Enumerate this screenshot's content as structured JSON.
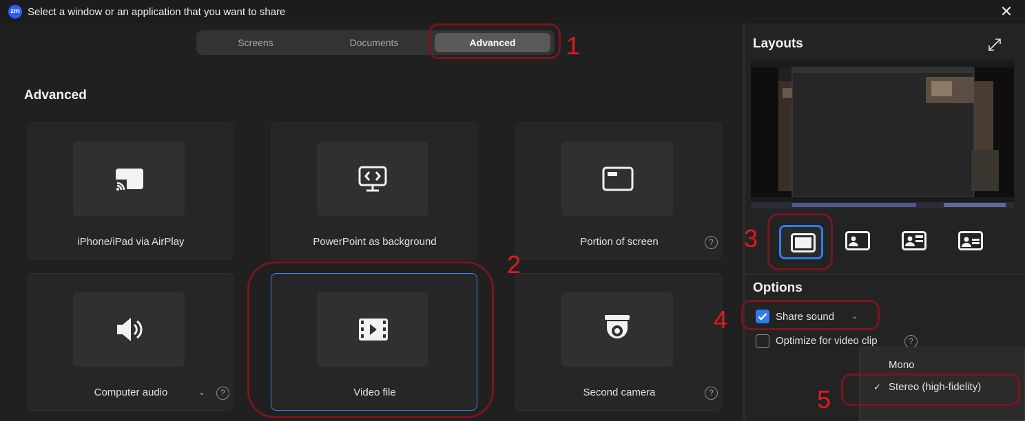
{
  "titlebar": {
    "logo": "zm",
    "title": "Select a window or an application that you want to share",
    "close": "✕"
  },
  "tabs": [
    {
      "label": "Screens",
      "selected": false
    },
    {
      "label": "Documents",
      "selected": false
    },
    {
      "label": "Advanced",
      "selected": true
    }
  ],
  "section_title": "Advanced",
  "cards": [
    {
      "label": "iPhone/iPad via AirPlay",
      "icon": "airplay-icon"
    },
    {
      "label": "PowerPoint as background",
      "icon": "powerpoint-slide-icon"
    },
    {
      "label": "Portion of screen",
      "icon": "portion-screen-icon",
      "help": "?"
    },
    {
      "label": "Computer audio",
      "icon": "speaker-icon",
      "help": "?",
      "chevron": "⌄"
    },
    {
      "label": "Video file",
      "icon": "video-file-icon",
      "selected": true
    },
    {
      "label": "Second camera",
      "icon": "camera-icon",
      "help": "?"
    }
  ],
  "right": {
    "layouts_title": "Layouts",
    "options_title": "Options",
    "layout_buttons": [
      "layout-screen-only-icon",
      "layout-person-left-icon",
      "layout-person-center-icon",
      "layout-person-right-icon"
    ],
    "share_sound": {
      "label": "Share sound",
      "checked": true,
      "chevron": "⌄"
    },
    "optimize": {
      "label": "Optimize for video clip",
      "checked": false,
      "help": "?"
    },
    "dropdown": [
      {
        "label": "Mono",
        "checked": false,
        "check": ""
      },
      {
        "label": "Stereo (high-fidelity)",
        "checked": true,
        "check": "✓"
      }
    ]
  },
  "annotations": [
    "1",
    "2",
    "3",
    "4",
    "5"
  ],
  "colors": {
    "accent": "#2f7cf0",
    "annotation_ring": "#7a1420",
    "annotation_number": "#e11b1b",
    "background": "#202020"
  }
}
